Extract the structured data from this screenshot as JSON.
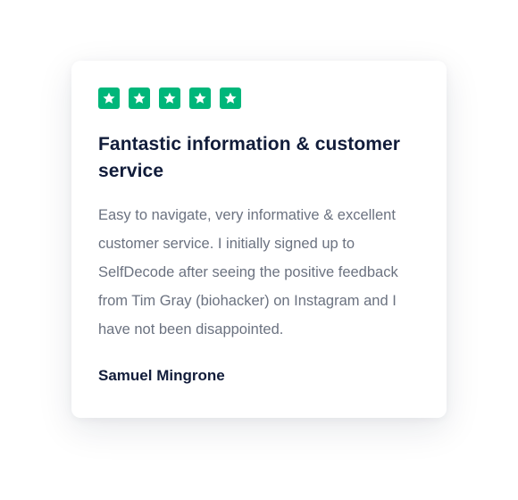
{
  "review": {
    "rating": 5,
    "rating_max": 5,
    "star_icon": "star-icon",
    "star_color": "#00b67a",
    "title": "Fantastic information & customer service",
    "body": "Easy to navigate, very informative & excellent customer service. I initially signed up to SelfDecode after seeing the positive feedback from Tim Gray (biohacker) on Instagram and I have not been disappointed.",
    "author": "Samuel Mingrone"
  },
  "colors": {
    "title": "#111c3a",
    "body_text": "#6b7280",
    "card_background": "#ffffff"
  }
}
